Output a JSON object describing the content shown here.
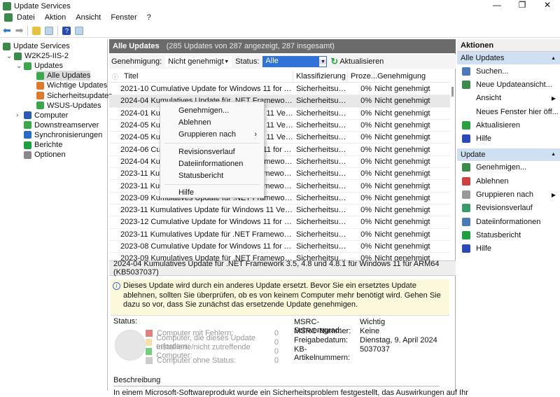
{
  "window": {
    "title": "Update Services",
    "controls": [
      "—",
      "❐",
      "✕"
    ]
  },
  "menu": [
    "Datei",
    "Aktion",
    "Ansicht",
    "Fenster",
    "?"
  ],
  "tree": [
    {
      "label": "Update Services",
      "level": 0,
      "color": "#3a8a4a"
    },
    {
      "label": "W2K25-IIS-2",
      "level": 1,
      "expander": "⌄",
      "color": "#3a8a4a"
    },
    {
      "label": "Updates",
      "level": 2,
      "expander": "⌄",
      "color": "#3aa84a"
    },
    {
      "label": "Alle Updates",
      "level": 3,
      "color": "#3aa84a",
      "selected": true
    },
    {
      "label": "Wichtige Updates",
      "level": 3,
      "color": "#e07a2a"
    },
    {
      "label": "Sicherheitsupdates",
      "level": 3,
      "color": "#e07a2a"
    },
    {
      "label": "WSUS-Updates",
      "level": 3,
      "color": "#3aa84a"
    },
    {
      "label": "Computer",
      "level": 2,
      "expander": "›",
      "color": "#2a5ab8"
    },
    {
      "label": "Downstreamserver",
      "level": 2,
      "color": "#3aa84a"
    },
    {
      "label": "Synchronisierungen",
      "level": 2,
      "color": "#2a6ac8"
    },
    {
      "label": "Berichte",
      "level": 2,
      "color": "#1ea040"
    },
    {
      "label": "Optionen",
      "level": 2,
      "color": "#888888"
    }
  ],
  "center": {
    "title": "Alle Updates",
    "summary": "(285 Updates von 287 angezeigt, 287 insgesamt)",
    "approval_label": "Genehmigung:",
    "approval_value": "Nicht genehmigt",
    "status_label": "Status:",
    "status_value": "Alle",
    "refresh_label": "Aktualisieren",
    "columns": [
      "Titel",
      "Klassifizierung",
      "Proze...",
      "Genehmigung"
    ],
    "rows": [
      [
        "2021-10 Cumulative Update for Windows 11 for ARM64-b...",
        "Sicherheitsupd...",
        "0%",
        "Nicht genehmigt"
      ],
      [
        "2024-04 Kumulatives Update für .NET Framework 3.5, 4.8 ...",
        "Sicherheitsupd...",
        "0%",
        "Nicht genehmigt"
      ],
      [
        "2024-01 Kumulatives Update für Windows 11 Version 22H2...",
        "Sicherheitsupd...",
        "0%",
        "Nicht genehmigt"
      ],
      [
        "2024-05 Kumulatives Update für Windows 11 Version 23H2...",
        "Sicherheitsupd...",
        "0%",
        "Nicht genehmigt"
      ],
      [
        "2024-05 Kumulatives Update für Windows 11 Version 22H2...",
        "Sicherheitsupd...",
        "0%",
        "Nicht genehmigt"
      ],
      [
        "2024-06 Cumulative Update for Windows 11 for ARM64-b...",
        "Sicherheitsupd...",
        "0%",
        "Nicht genehmigt"
      ],
      [
        "2024-04 Kumulatives Update für .NET Framework 3.5 und ...",
        "Sicherheitsupd...",
        "0%",
        "Nicht genehmigt"
      ],
      [
        "2023-11 Kumulatives Update für .NET Framework 3.5, 4.8 ...",
        "Sicherheitsupd...",
        "0%",
        "Nicht genehmigt"
      ],
      [
        "2023-11 Kumulatives Update für .NET Framework 3.5, 4.8 ...",
        "Sicherheitsupd...",
        "0%",
        "Nicht genehmigt"
      ],
      [
        "2023-09 Kumulatives Update für .NET Framework 3.5 und ...",
        "Sicherheitsupd...",
        "0%",
        "Nicht genehmigt"
      ],
      [
        "2023-11 Kumulatives Update für Windows 11 Version 23H2...",
        "Sicherheitsupd...",
        "0%",
        "Nicht genehmigt"
      ],
      [
        "2023-12 Cumulative Update for Windows 11 for x64-based...",
        "Sicherheitsupd...",
        "0%",
        "Nicht genehmigt"
      ],
      [
        "2023-11 Kumulatives Update für .NET Framework 3.5 und ...",
        "Sicherheitsupd...",
        "0%",
        "Nicht genehmigt"
      ],
      [
        "2023-08 Cumulative Update for Windows 11 for ARM64-b...",
        "Sicherheitsupd...",
        "0%",
        "Nicht genehmigt"
      ],
      [
        "2023-09 Kumulatives Update für .NET Framework 3.5 und ...",
        "Sicherheitsupd...",
        "0%",
        "Nicht genehmigt"
      ]
    ],
    "context_menu": [
      "Genehmigen...",
      "Ablehnen",
      "Gruppieren nach",
      "Revisionsverlauf",
      "Dateiinformationen",
      "Statusbericht",
      "Hilfe"
    ],
    "selected_title": "2024-04 Kumulatives Update für .NET Framework 3.5, 4.8 und 4.8.1 für Windows 11 für ARM64 (KB5037037)",
    "info": "Dieses Update wird durch ein anderes Update ersetzt. Bevor Sie ein ersetztes Update ablehnen, sollten Sie überprüfen, ob es von keinem Computer mehr benötigt wird. Gehen Sie dazu so vor, dass Sie zunächst das ersetzende Update genehmigen.",
    "status_heading": "Status:",
    "legend": [
      {
        "label": "Computer mit Fehlern:",
        "count": "0",
        "color": "#e08080"
      },
      {
        "label": "Computer, die dieses Update erfordern:",
        "count": "0",
        "color": "#f5dfa8"
      },
      {
        "label": "Installierte/nicht zutreffende Computer:",
        "count": "0",
        "color": "#70d080"
      },
      {
        "label": "Computer ohne Status:",
        "count": "0",
        "color": "#cccccc"
      }
    ],
    "properties": [
      {
        "k": "MSRC-Schweregrad:",
        "v": "Wichtig"
      },
      {
        "k": "MSRC-Nummer:",
        "v": "Keine"
      },
      {
        "k": "Freigabedatum:",
        "v": "Dienstag, 9. April 2024"
      },
      {
        "k": "KB-Artikelnummern:",
        "v": "5037037"
      }
    ],
    "description_heading": "Beschreibung",
    "description": "In einem Microsoft-Softwareprodukt wurde ein Sicherheitsproblem festgestellt, das Auswirkungen auf Ihr"
  },
  "actions": {
    "title": "Aktionen",
    "sections": [
      {
        "title": "Alle Updates",
        "items": [
          {
            "label": "Suchen...",
            "color": "#4a7ab8"
          },
          {
            "label": "Neue Updateansicht...",
            "color": "#3a8a4a"
          },
          {
            "label": "Ansicht",
            "submenu": true
          },
          {
            "label": "Neues Fenster hier öff..."
          },
          {
            "label": "Aktualisieren",
            "color": "#2aa040"
          },
          {
            "label": "Hilfe",
            "color": "#2a4ab8"
          }
        ]
      },
      {
        "title": "Update",
        "items": [
          {
            "label": "Genehmigen...",
            "color": "#3a8a4a"
          },
          {
            "label": "Ablehnen",
            "color": "#d04040"
          },
          {
            "label": "Gruppieren nach",
            "submenu": true,
            "color": "#999999"
          },
          {
            "label": "Revisionsverlauf",
            "color": "#3a9a6a"
          },
          {
            "label": "Dateiinformationen",
            "color": "#4a7ab8"
          },
          {
            "label": "Statusbericht",
            "color": "#1ea040"
          },
          {
            "label": "Hilfe",
            "color": "#2a4ab8"
          }
        ]
      }
    ]
  }
}
